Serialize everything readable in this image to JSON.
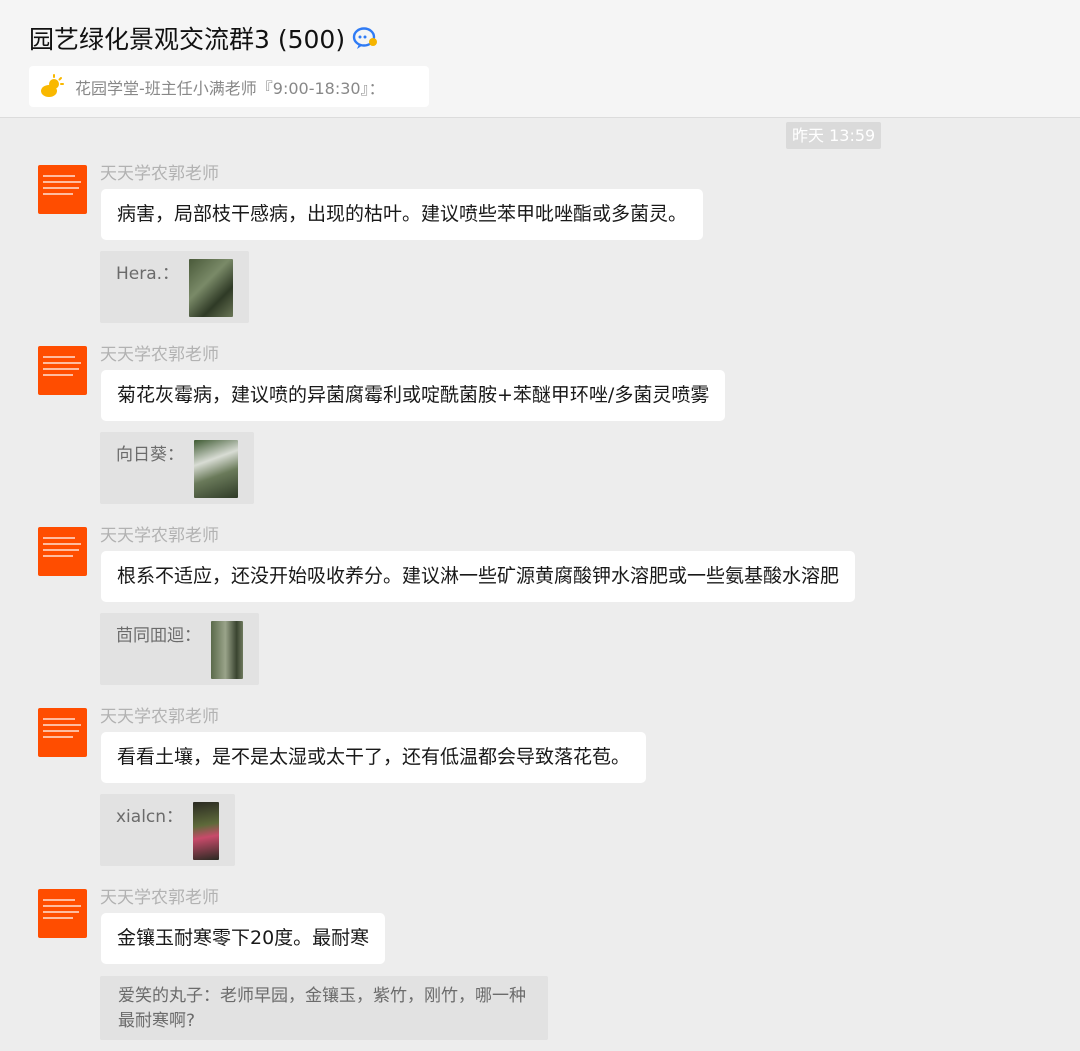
{
  "header": {
    "title": "园艺绿化景观交流群3 (500)",
    "notice": "花园学堂-班主任小满老师『9:00-18:30』："
  },
  "timestamp": "昨天 13:59",
  "messages": [
    {
      "sender": "天天学农郭老师",
      "text": "病害，局部枝干感病，出现的枯叶。建议喷些苯甲吡唑酯或多菌灵。",
      "quote_name": "Hera.：",
      "thumb_colors": [
        "#4a5a3a",
        "#7a8a68",
        "#2f3a26"
      ]
    },
    {
      "sender": "天天学农郭老师",
      "text": "菊花灰霉病，建议喷的异菌腐霉利或啶酰菌胺+苯醚甲环唑/多菌灵喷雾",
      "quote_name": "向日葵：",
      "thumb_colors": [
        "#3e5a32",
        "#d8dcd4",
        "#6a7a5a"
      ]
    },
    {
      "sender": "天天学农郭老师",
      "text": "根系不适应，还没开始吸收养分。建议淋一些矿源黄腐酸钾水溶肥或一些氨基酸水溶肥",
      "quote_name": "茴同囬迴：",
      "thumb_colors": [
        "#5a6a4a",
        "#9aa48a",
        "#3a4430"
      ]
    },
    {
      "sender": "天天学农郭老师",
      "text": "看看土壤，是不是太湿或太干了，还有低温都会导致落花苞。",
      "quote_name": "xialcn：",
      "thumb_colors": [
        "#2a2a22",
        "#5e6a3a",
        "#c84a6a"
      ]
    },
    {
      "sender": "天天学农郭老师",
      "text": "金镶玉耐寒零下20度。最耐寒",
      "quote_text": "爱笑的丸子：老师早园，金镶玉，紫竹，刚竹，哪一种最耐寒啊?"
    }
  ],
  "colors": {
    "avatar_bg": "#ff4d00",
    "bubble_bg": "#ffffff",
    "page_bg": "#ededed"
  },
  "icons": {
    "title_icon": "chat-bubble-icon",
    "notice_icon": "sun-cloud-icon"
  }
}
